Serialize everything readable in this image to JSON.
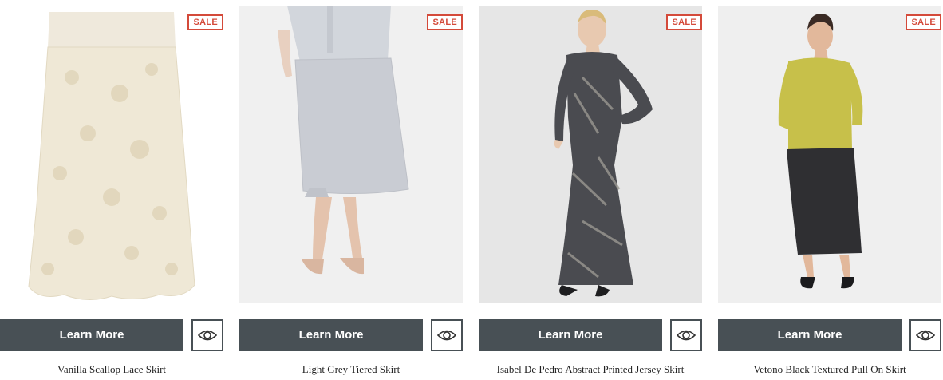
{
  "products": [
    {
      "name": "Vanilla Scallop Lace Skirt",
      "badge": "SALE",
      "button": "Learn More",
      "quick_view_icon": "eye-icon"
    },
    {
      "name": "Light Grey Tiered Skirt",
      "badge": "SALE",
      "button": "Learn More",
      "quick_view_icon": "eye-icon"
    },
    {
      "name": "Isabel De Pedro Abstract Printed Jersey Skirt",
      "badge": "SALE",
      "button": "Learn More",
      "quick_view_icon": "eye-icon"
    },
    {
      "name": "Vetono Black Textured Pull On Skirt",
      "badge": "SALE",
      "button": "Learn More",
      "quick_view_icon": "eye-icon"
    }
  ],
  "colors": {
    "button_bg": "#485055",
    "sale": "#d44a3a",
    "text": "#222222"
  }
}
